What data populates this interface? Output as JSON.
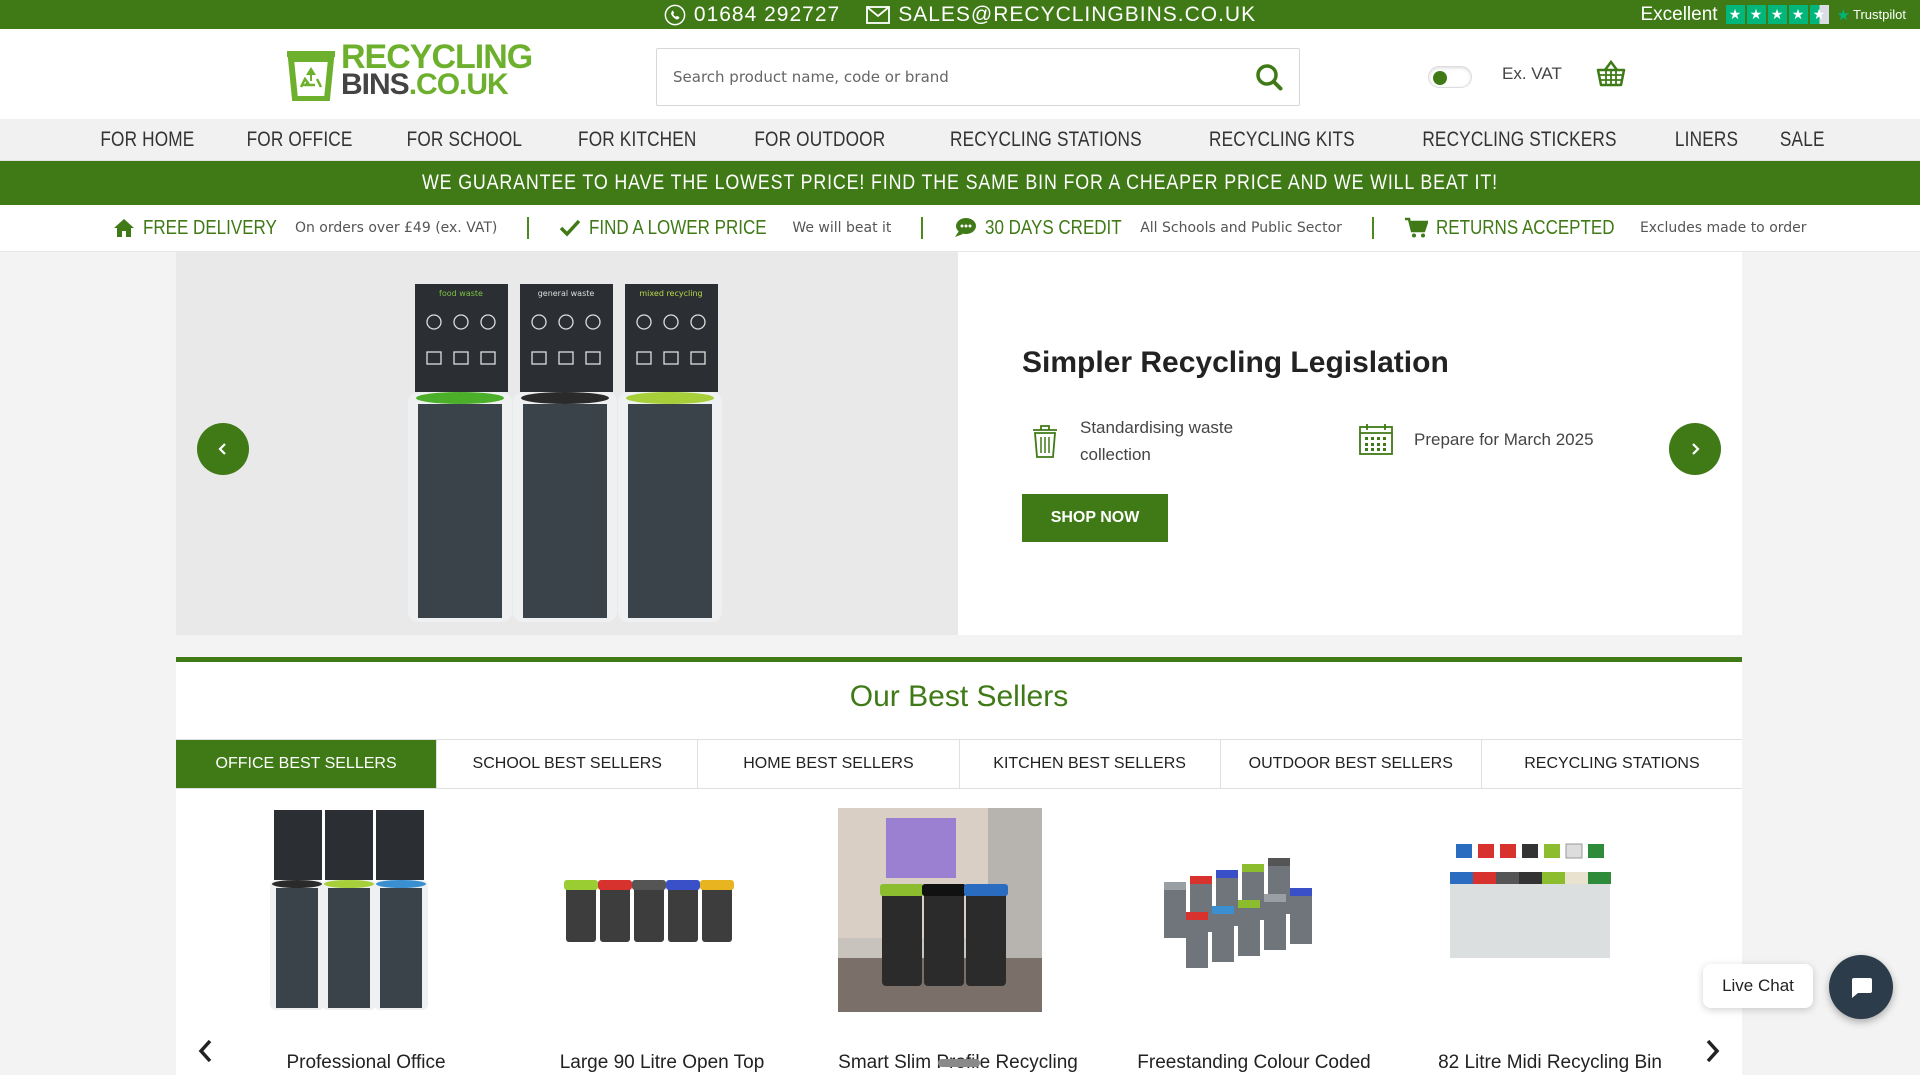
{
  "topbar": {
    "phone": "01684 292727",
    "email": "SALES@RECYCLINGBINS.CO.UK",
    "rating_word": "Excellent",
    "trustpilot_label": "Trustpilot",
    "stars": 4.5
  },
  "header": {
    "logo_line1": "RECYCLING",
    "logo_line2": "BINS",
    "logo_tld": ".CO.UK",
    "search_placeholder": "Search product name, code or brand",
    "vat_label": "Ex. VAT"
  },
  "nav": {
    "items": [
      "FOR HOME",
      "FOR OFFICE",
      "FOR SCHOOL",
      "FOR KITCHEN",
      "FOR OUTDOOR",
      "RECYCLING STATIONS",
      "RECYCLING KITS",
      "RECYCLING STICKERS",
      "LINERS",
      "SALE"
    ]
  },
  "guarantee": "WE GUARANTEE TO HAVE THE LOWEST PRICE! FIND THE SAME BIN FOR A CHEAPER PRICE AND WE WILL BEAT IT!",
  "usp": [
    {
      "title": "FREE DELIVERY",
      "sub": "On orders over £49 (ex. VAT)"
    },
    {
      "title": "FIND A LOWER PRICE",
      "sub": "We will beat it"
    },
    {
      "title": "30 DAYS CREDIT",
      "sub": "All Schools and Public Sector"
    },
    {
      "title": "RETURNS ACCEPTED",
      "sub": "Excludes made to order"
    }
  ],
  "hero": {
    "title": "Simpler Recycling Legislation",
    "feature1": "Standardising waste collection",
    "feature2": "Prepare for March 2025",
    "button": "SHOP NOW",
    "bin_labels": [
      "food waste",
      "general waste",
      "mixed recycling"
    ]
  },
  "best_sellers": {
    "heading": "Our Best Sellers",
    "tabs": [
      "OFFICE BEST SELLERS",
      "SCHOOL BEST SELLERS",
      "HOME BEST SELLERS",
      "KITCHEN BEST SELLERS",
      "OUTDOOR BEST SELLERS",
      "RECYCLING STATIONS"
    ],
    "active_tab": 0,
    "products": [
      "Professional Office",
      "Large 90 Litre Open Top",
      "Smart Slim Profile Recycling",
      "Freestanding Colour Coded",
      "82 Litre Midi Recycling Bin"
    ]
  },
  "chat": {
    "label": "Live Chat"
  },
  "colors": {
    "brand_green": "#3f7a16",
    "logo_green": "#6db02d",
    "trustpilot_green": "#00b67a"
  }
}
